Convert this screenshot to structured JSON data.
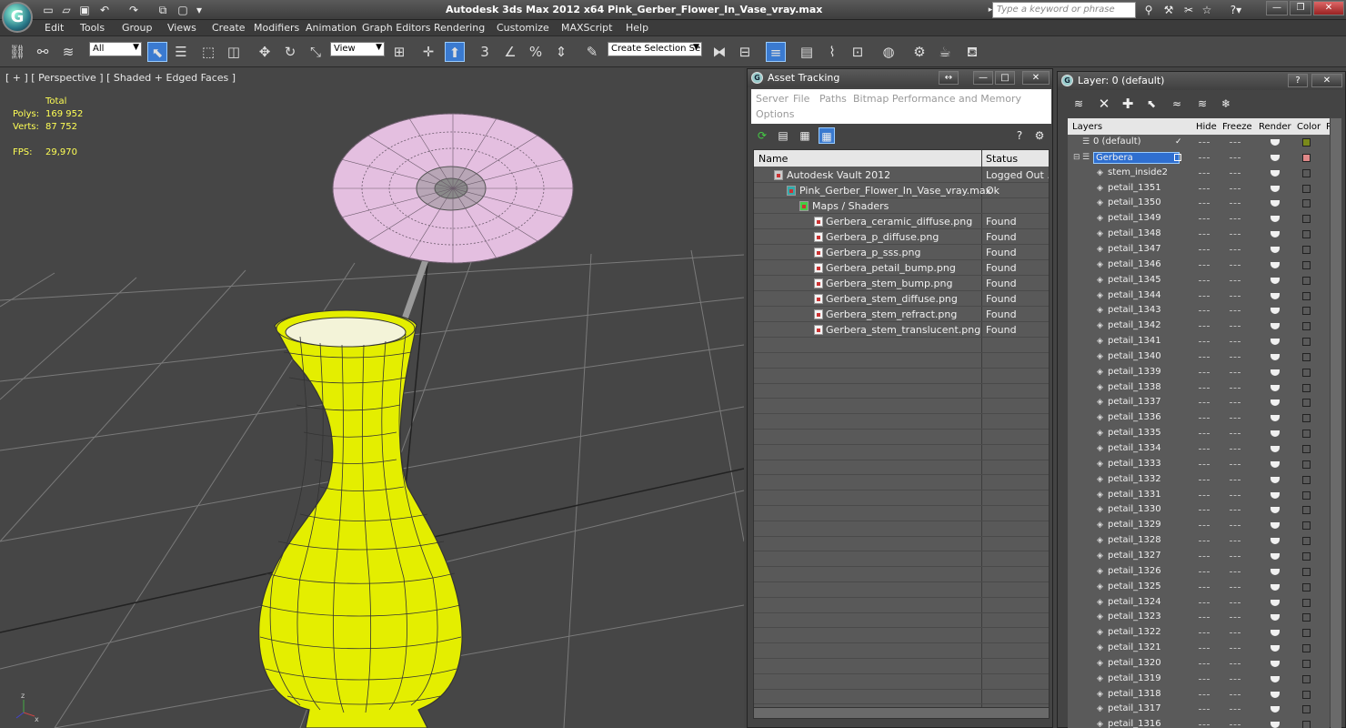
{
  "window": {
    "title": "Autodesk 3ds Max  2012 x64      Pink_Gerber_Flower_In_Vase_vray.max",
    "search_placeholder": "Type a keyword or phrase"
  },
  "menu": [
    "Edit",
    "Tools",
    "Group",
    "Views",
    "Create",
    "Modifiers",
    "Animation",
    "Graph Editors",
    "Rendering",
    "Customize",
    "MAXScript",
    "Help"
  ],
  "toolbar": {
    "filter_select": "All",
    "view_select": "View",
    "selection_set": "Create Selection Se",
    "snap_value": "3",
    "accent": "#3a7ad0"
  },
  "viewport": {
    "label": "[ + ] [ Perspective ] [ Shaded + Edged Faces ]",
    "total_label": "Total",
    "polys_label": "Polys:",
    "polys_value": "169 952",
    "verts_label": "Verts:",
    "verts_value": "87 752",
    "fps_label": "FPS:",
    "fps_value": "29,970",
    "vase_color": "#e4ee00",
    "petal_color": "#e4bfe0"
  },
  "asset_tracking": {
    "title": "Asset Tracking",
    "menu": [
      "Server",
      "File",
      "Paths",
      "Bitmap Performance and Memory"
    ],
    "menu2": "Options",
    "col_name": "Name",
    "col_status": "Status",
    "rows": [
      {
        "name": "Autodesk Vault 2012",
        "status": "Logged Out ..."
      },
      {
        "name": "Pink_Gerber_Flower_In_Vase_vray.max",
        "status": "Ok"
      },
      {
        "name": "Maps / Shaders",
        "status": ""
      },
      {
        "name": "Gerbera_ceramic_diffuse.png",
        "status": "Found"
      },
      {
        "name": "Gerbera_p_diffuse.png",
        "status": "Found"
      },
      {
        "name": "Gerbera_p_sss.png",
        "status": "Found"
      },
      {
        "name": "Gerbera_petail_bump.png",
        "status": "Found"
      },
      {
        "name": "Gerbera_stem_bump.png",
        "status": "Found"
      },
      {
        "name": "Gerbera_stem_diffuse.png",
        "status": "Found"
      },
      {
        "name": "Gerbera_stem_refract.png",
        "status": "Found"
      },
      {
        "name": "Gerbera_stem_translucent.png",
        "status": "Found"
      }
    ]
  },
  "layers": {
    "title": "Layer: 0 (default)",
    "col_layers": "Layers",
    "col_hide": "Hide",
    "col_freeze": "Freeze",
    "col_render": "Render",
    "col_color": "Color",
    "col_radiosity": "R",
    "rows": [
      {
        "name": "0 (default)",
        "swatch": "#7a8a1a"
      },
      {
        "name": "Gerbera",
        "swatch": "#e08888"
      },
      {
        "name": "stem_inside2"
      },
      {
        "name": "petail_1351"
      },
      {
        "name": "petail_1350"
      },
      {
        "name": "petail_1349"
      },
      {
        "name": "petail_1348"
      },
      {
        "name": "petail_1347"
      },
      {
        "name": "petail_1346"
      },
      {
        "name": "petail_1345"
      },
      {
        "name": "petail_1344"
      },
      {
        "name": "petail_1343"
      },
      {
        "name": "petail_1342"
      },
      {
        "name": "petail_1341"
      },
      {
        "name": "petail_1340"
      },
      {
        "name": "petail_1339"
      },
      {
        "name": "petail_1338"
      },
      {
        "name": "petail_1337"
      },
      {
        "name": "petail_1336"
      },
      {
        "name": "petail_1335"
      },
      {
        "name": "petail_1334"
      },
      {
        "name": "petail_1333"
      },
      {
        "name": "petail_1332"
      },
      {
        "name": "petail_1331"
      },
      {
        "name": "petail_1330"
      },
      {
        "name": "petail_1329"
      },
      {
        "name": "petail_1328"
      },
      {
        "name": "petail_1327"
      },
      {
        "name": "petail_1326"
      },
      {
        "name": "petail_1325"
      },
      {
        "name": "petail_1324"
      },
      {
        "name": "petail_1323"
      },
      {
        "name": "petail_1322"
      },
      {
        "name": "petail_1321"
      },
      {
        "name": "petail_1320"
      },
      {
        "name": "petail_1319"
      },
      {
        "name": "petail_1318"
      },
      {
        "name": "petail_1317"
      },
      {
        "name": "petail_1316"
      }
    ]
  }
}
